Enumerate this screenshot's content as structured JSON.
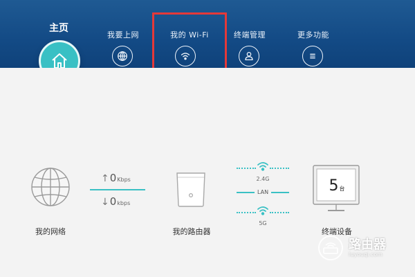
{
  "nav": {
    "home": {
      "label": "主页",
      "icon": "home-icon"
    },
    "items": [
      {
        "label": "我要上网",
        "icon": "globe-icon"
      },
      {
        "label": "我的 Wi-Fi",
        "icon": "wifi-icon"
      },
      {
        "label": "终端管理",
        "icon": "user-icon"
      },
      {
        "label": "更多功能",
        "icon": "menu-icon"
      }
    ]
  },
  "status": {
    "network_label": "我的网络",
    "upload": {
      "value": "0",
      "unit": "Kbps"
    },
    "download": {
      "value": "0",
      "unit": "kbps"
    },
    "router_label": "我的路由器",
    "band_24": "2.4G",
    "lan": "LAN",
    "band_5": "5G",
    "devices": {
      "count": "5",
      "unit": "台",
      "label": "终端设备"
    }
  },
  "watermark": {
    "name": "路由器",
    "site": "luyouqi.com"
  },
  "colors": {
    "header": "#134a85",
    "accent": "#39c0c4",
    "highlight": "#e53939"
  }
}
